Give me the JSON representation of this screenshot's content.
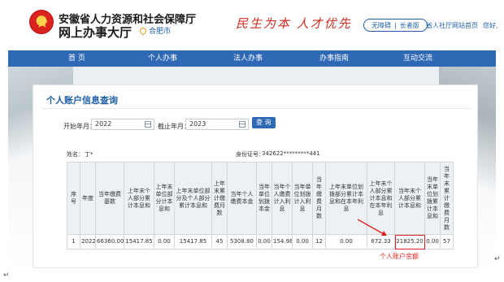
{
  "header": {
    "org_name": "安徽省人力资源和社会保障厅",
    "hall_name": "网上办事大厅",
    "location": "合肥市",
    "slogan": "民生为本 人才优先",
    "toggle_accessible": "无障碍",
    "toggle_elderly": "长者版",
    "link_home": "省人社厅网站首页",
    "link_greeting": "您好,"
  },
  "nav": {
    "items": [
      {
        "label": "首 页"
      },
      {
        "label": "个人办事"
      },
      {
        "label": "法人办事"
      },
      {
        "label": "办事指南"
      },
      {
        "label": "互动交流"
      }
    ]
  },
  "page": {
    "title": "个人账户信息查询"
  },
  "filter": {
    "start_label": "开始年月：",
    "start_value": "2022",
    "end_label": "截止年月：",
    "end_value": "2023",
    "query_button": "查 询"
  },
  "person": {
    "name_label": "姓名：",
    "name_value": "丁*",
    "id_label": "身份证号：",
    "id_value": "342622*********441"
  },
  "table": {
    "headers": [
      "序号",
      "年度",
      "当年缴费基数",
      "上年末个人部分累计本息和",
      "上年末单位部分计本息和",
      "上年末单位部分及个人部分累计本息和",
      "上年末累计缴费月数",
      "当年个人缴费本金",
      "当年单位划拨本金",
      "当年个人缴费计入利息",
      "当年单位划拨计入利息",
      "当年缴费月数",
      "上年末单位划拨部分累计本息和在本年利息",
      "上年末个人部分累计本息和在本年利息",
      "当年末个人部分累计本息和",
      "当年末单位划拨累计本息和",
      "当年末累计缴费月数"
    ],
    "rows": [
      [
        "1",
        "2022",
        "66360.00",
        "15417.85",
        "0.00",
        "15417.85",
        "45",
        "5308.80",
        "0.00",
        "154.98",
        "0.00",
        "12",
        "0.00",
        "672.33",
        "21825.20",
        "0.00",
        "57"
      ]
    ]
  },
  "annotation": {
    "label": "个人账户余额"
  },
  "colors": {
    "brand_blue": "#2f69b6",
    "highlight_red": "#e02020",
    "slogan_red": "#d22a1f"
  }
}
